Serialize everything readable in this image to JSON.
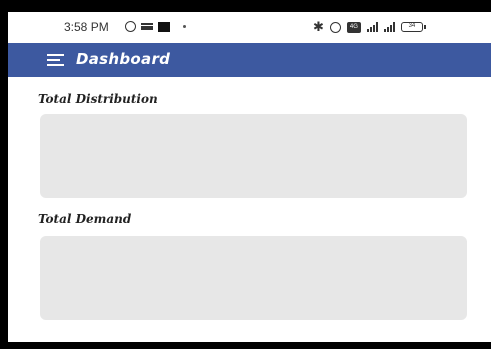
{
  "status_bar": {
    "time": "3:58 PM",
    "left_icons": [
      "whatsapp-icon",
      "message-icon",
      "square-notification-icon",
      "dot-icon"
    ],
    "right_icons": [
      "bluetooth-icon",
      "alarm-icon",
      "volte-icon",
      "signal-icon",
      "signal-icon",
      "battery-icon"
    ],
    "volte_label": "4G",
    "battery_level": "34"
  },
  "app_bar": {
    "title": "Dashboard",
    "background_color": "#3d59a0",
    "menu_icon": "hamburger-menu-icon"
  },
  "sections": [
    {
      "label": "Total Distribution"
    },
    {
      "label": "Total Demand"
    }
  ],
  "colors": {
    "card_background": "#e7e7e7"
  }
}
